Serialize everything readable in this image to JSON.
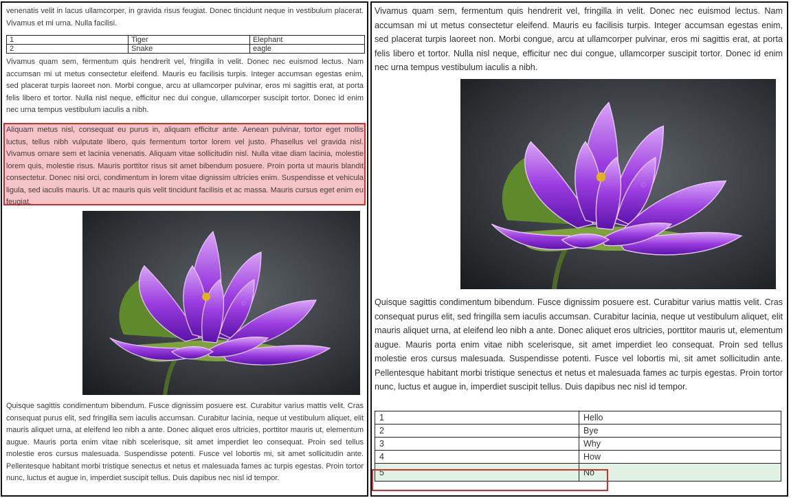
{
  "left_panel": {
    "top_paragraph": "venenatis velit in lacus ullamcorper, in gravida risus feugiat. Donec tincidunt neque in vestibulum placerat. Vivamus et mi urna. Nulla facilisi.",
    "table": {
      "rows": [
        [
          "1",
          "Tiger",
          "Elephant"
        ],
        [
          "2",
          "Snake",
          "eagle"
        ]
      ]
    },
    "paragraph_after_table": "Vivamus quam sem, fermentum quis hendrerit vel, fringilla in velit. Donec nec euismod lectus. Nam accumsan mi ut metus consectetur eleifend. Mauris eu facilisis turpis. Integer accumsan egestas enim, sed placerat turpis laoreet non. Morbi congue, arcu at ullamcorper pulvinar, eros mi sagittis erat, at porta felis libero et tortor. Nulla nisl neque, efficitur nec dui congue, ullamcorper suscipit tortor. Donec id enim nec urna tempus vestibulum iaculis a nibh.",
    "highlighted_paragraph": "Aliquam metus nisl, consequat eu purus in, aliquam efficitur ante. Aenean pulvinar, tortor eget mollis luctus, tellus nibh vulputate libero, quis fermentum tortor lorem vel justo. Phasellus vel gravida nisl. Vivamus ornare sem et lacinia venenatis. Aliquam vitae sollicitudin nisl. Nulla vitae diam lacinia, molestie lorem quis, molestie risus. Mauris porttitor risus sit amet bibendum posuere. Proin porta ut mauris blandit consectetur. Donec nisi orci, condimentum in lorem vitae dignissim ultricies enim. Suspendisse et vehicula ligula, sed iaculis mauris. Ut ac mauris quis velit tincidunt facilisis et ac massa. Mauris cursus eget enim eu feugiat.",
    "bottom_paragraph": "Quisque sagittis condimentum bibendum. Fusce dignissim posuere est. Curabitur varius mattis velit. Cras consequat purus elit, sed fringilla sem iaculis accumsan. Curabitur lacinia, neque ut vestibulum aliquet, elit mauris aliquet urna, at eleifend leo nibh a ante. Donec aliquet eros ultricies, porttitor mauris ut, elementum augue. Mauris porta enim vitae nibh scelerisque, sit amet imperdiet leo consequat. Proin sed tellus molestie eros cursus malesuada. Suspendisse potenti. Fusce vel lobortis mi, sit amet sollicitudin ante. Pellentesque habitant morbi tristique senectus et netus et malesuada fames ac turpis egestas. Proin tortor nunc, luctus et augue in, imperdiet suscipit tellus. Duis dapibus nec nisl id tempor.",
    "image_icon": "purple-lotus-flower-image",
    "highlight_color": "#f5c4c9",
    "highlight_border_color": "#d82b2b"
  },
  "right_panel": {
    "top_paragraph": "Vivamus quam sem, fermentum quis hendrerit vel, fringilla in velit. Donec nec euismod lectus. Nam accumsan mi ut metus consectetur eleifend. Mauris eu facilisis turpis. Integer accumsan egestas enim, sed placerat turpis laoreet non. Morbi congue, arcu at ullamcorper pulvinar, eros mi sagittis erat, at porta felis libero et tortor. Nulla nisl neque, efficitur nec dui congue, ullamcorper suscipit tortor. Donec id enim nec urna tempus vestibulum iaculis a nibh.",
    "bottom_paragraph": "Quisque sagittis condimentum bibendum. Fusce dignissim posuere est. Curabitur varius mattis velit. Cras consequat purus elit, sed fringilla sem iaculis accumsan. Curabitur lacinia, neque ut vestibulum aliquet, elit mauris aliquet urna, at eleifend leo nibh a ante. Donec aliquet eros ultricies, porttitor mauris ut, elementum augue. Mauris porta enim vitae nibh scelerisque, sit amet imperdiet leo consequat. Proin sed tellus molestie eros cursus malesuada. Suspendisse potenti. Fusce vel lobortis mi, sit amet sollicitudin ante. Pellentesque habitant morbi tristique senectus et netus et malesuada fames ac turpis egestas. Proin tortor nunc, luctus et augue in, imperdiet suscipit tellus. Duis dapibus nec nisl id tempor.",
    "table": {
      "rows": [
        [
          "1",
          "Hello"
        ],
        [
          "2",
          "Bye"
        ],
        [
          "3",
          "Why"
        ],
        [
          "4",
          "How"
        ],
        [
          "5",
          "No"
        ]
      ]
    },
    "image_icon": "purple-lotus-flower-image",
    "outline_color": "#cf2f2f"
  }
}
